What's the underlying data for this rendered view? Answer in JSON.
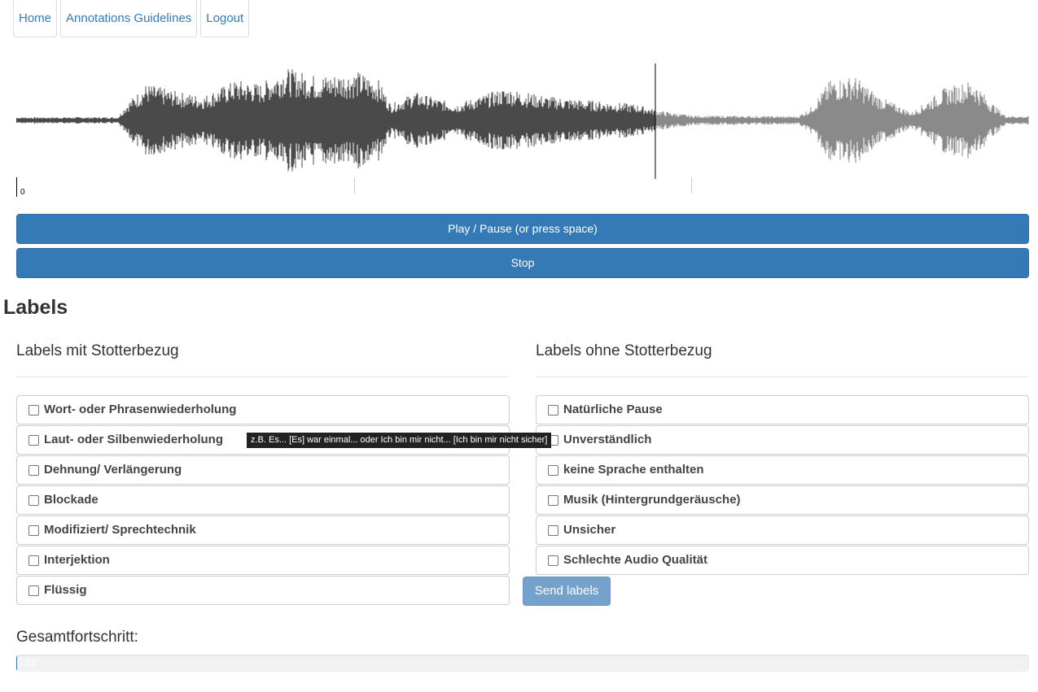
{
  "nav": {
    "home": "Home",
    "guidelines": "Annotations Guidelines",
    "logout": "Logout"
  },
  "player": {
    "played_fraction": 0.631,
    "played_color": "#4a4a4a",
    "unplayed_color": "#8a8a8a",
    "timeline_start": "0"
  },
  "buttons": {
    "play_pause": "Play / Pause (or press space)",
    "stop": "Stop",
    "send": "Send labels"
  },
  "labels": {
    "title": "Labels",
    "left_title": "Labels mit Stotterbezug",
    "right_title": "Labels ohne Stotterbezug",
    "left": [
      "Wort- oder Phrasenwiederholung",
      "Laut- oder Silbenwiederholung",
      "Dehnung/ Verlängerung",
      "Blockade",
      "Modifiziert/ Sprechtechnik",
      "Interjektion",
      "Flüssig"
    ],
    "right": [
      "Natürliche Pause",
      "Unverständlich",
      "keine Sprache enthalten",
      "Musik (Hintergrundgeräusche)",
      "Unsicher",
      "Schlechte Audio Qualität"
    ]
  },
  "tooltip": "z.B. Es... [Es] war einmal... oder Ich bin mir nicht... [Ich bin mir nicht sicher]",
  "progress": {
    "label": "Gesamtfortschritt:",
    "value": "0.02",
    "fraction": 0.0002
  }
}
